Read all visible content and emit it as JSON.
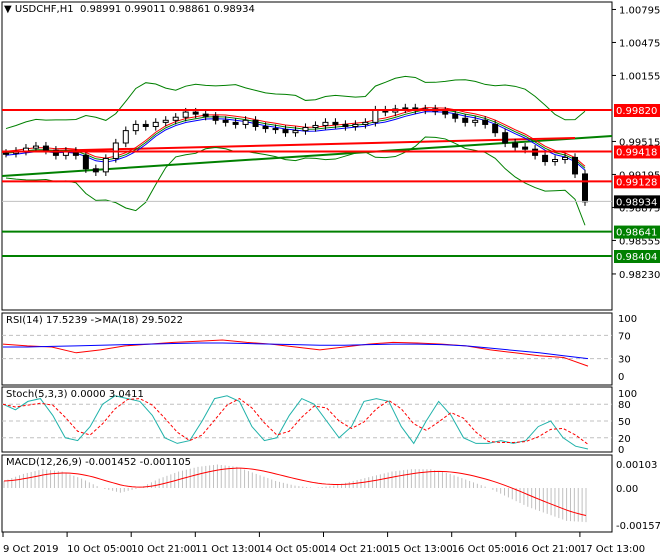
{
  "header": {
    "symbol": "USDCHF,H1",
    "ohlc": "0.98991 0.99011 0.98861 0.98934"
  },
  "colors": {
    "up": "#000000",
    "down": "#000000",
    "bands": "#008000",
    "resistance": "#ff0000",
    "support": "#008000",
    "current": "#000000",
    "rsi": "#ff0000",
    "rsi_ma": "#0000ff",
    "stoch_main": "#20b2aa",
    "stoch_signal": "#ff0000",
    "macd_hist": "#c0c0c0",
    "macd_signal": "#ff0000"
  },
  "price_axis": {
    "ticks": [
      "1.00795",
      "1.00475",
      "1.00155",
      "0.99515",
      "0.99195",
      "0.98875",
      "0.98555",
      "0.98230"
    ],
    "levels": [
      {
        "value": "0.99820",
        "kind": "resistance"
      },
      {
        "value": "0.99418",
        "kind": "resistance"
      },
      {
        "value": "0.99128",
        "kind": "resistance"
      },
      {
        "value": "0.98934",
        "kind": "current"
      },
      {
        "value": "0.98641",
        "kind": "support"
      },
      {
        "value": "0.98404",
        "kind": "support"
      }
    ]
  },
  "chart_data": [
    {
      "type": "candlestick",
      "title": "USDCHF,H1",
      "ylim": [
        0.9823,
        1.00795
      ],
      "closes": [
        0.994,
        0.9942,
        0.9945,
        0.9947,
        0.9943,
        0.9938,
        0.9942,
        0.9938,
        0.9925,
        0.9922,
        0.9935,
        0.995,
        0.9962,
        0.9968,
        0.9966,
        0.997,
        0.9972,
        0.9975,
        0.998,
        0.9978,
        0.9976,
        0.9972,
        0.997,
        0.9968,
        0.9972,
        0.9966,
        0.9964,
        0.9963,
        0.996,
        0.9962,
        0.9965,
        0.9967,
        0.997,
        0.9968,
        0.9966,
        0.9968,
        0.997,
        0.9982,
        0.998,
        0.9983,
        0.9984,
        0.9982,
        0.9983,
        0.9981,
        0.9978,
        0.9974,
        0.997,
        0.9972,
        0.9968,
        0.996,
        0.995,
        0.9946,
        0.9944,
        0.9938,
        0.9932,
        0.9934,
        0.9936,
        0.992,
        0.9893
      ]
    },
    {
      "type": "line",
      "title": "RSI(14) 17.5239  ->MA(18) 29.5022",
      "ylim": [
        0,
        100
      ],
      "ticks": [
        "100",
        "70",
        "30",
        "0"
      ],
      "rsi": [
        55,
        52,
        50,
        40,
        45,
        52,
        55,
        58,
        60,
        62,
        58,
        55,
        50,
        45,
        50,
        55,
        58,
        57,
        55,
        52,
        45,
        40,
        35,
        32,
        17
      ],
      "ma": [
        50,
        50,
        51,
        52,
        53,
        54,
        55,
        56,
        57,
        57,
        56,
        55,
        54,
        53,
        53,
        54,
        55,
        55,
        54,
        52,
        48,
        44,
        40,
        35,
        30
      ]
    },
    {
      "type": "line",
      "title": "Stoch(5,3,3) 0.0000 3.0411",
      "ylim": [
        0,
        100
      ],
      "ticks": [
        "100",
        "80",
        "50",
        "20",
        "0"
      ],
      "k": [
        80,
        70,
        85,
        90,
        60,
        20,
        15,
        40,
        80,
        95,
        90,
        85,
        60,
        20,
        10,
        15,
        50,
        90,
        95,
        85,
        40,
        15,
        20,
        60,
        90,
        80,
        50,
        20,
        40,
        85,
        90,
        85,
        40,
        10,
        50,
        85,
        60,
        20,
        10,
        10,
        15,
        10,
        15,
        40,
        50,
        20,
        5,
        0
      ]
    },
    {
      "type": "bar",
      "title": "MACD(12,26,9) -0.001452 -0.001105",
      "ylim": [
        -0.001571,
        0.00103
      ],
      "ticks": [
        "0.00103",
        "0.00",
        "-0.001571"
      ],
      "macd": [
        0.0003,
        0.0006,
        0.0008,
        0.0007,
        0.0004,
        0.0,
        -0.0002,
        0.0,
        0.0004,
        0.0007,
        0.0009,
        0.001,
        0.0009,
        0.0006,
        0.0003,
        0.0001,
        0.0,
        0.0001,
        0.0003,
        0.0005,
        0.0007,
        0.0008,
        0.0008,
        0.0006,
        0.0003,
        0.0,
        -0.0004,
        -0.0008,
        -0.0011,
        -0.0014,
        -0.00145
      ]
    }
  ],
  "time_axis": [
    "9 Oct 2019",
    "10 Oct 05:00",
    "10 Oct 21:00",
    "11 Oct 13:00",
    "14 Oct 05:00",
    "14 Oct 21:00",
    "15 Oct 13:00",
    "16 Oct 05:00",
    "16 Oct 21:00",
    "17 Oct 13:00"
  ]
}
